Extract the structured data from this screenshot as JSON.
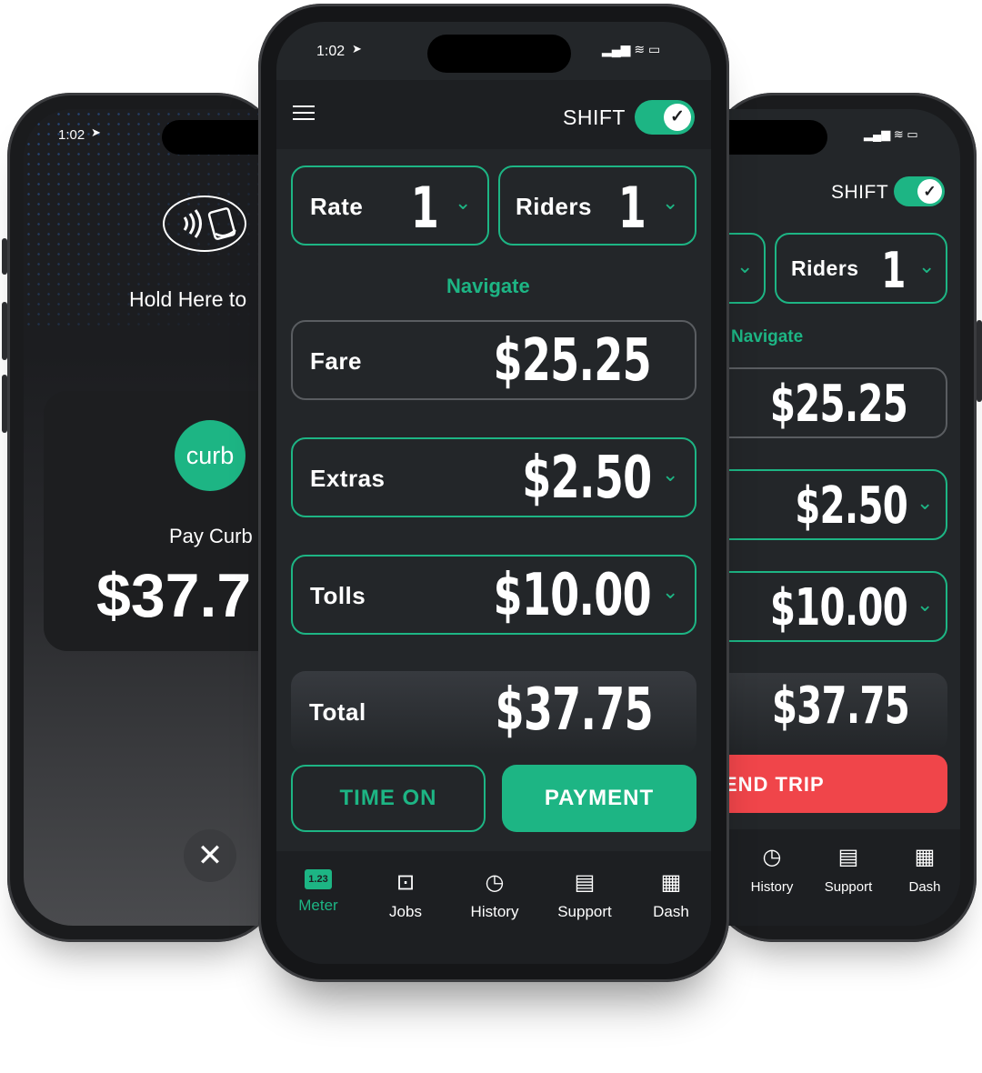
{
  "left_phone": {
    "time": "1:02",
    "hold_text": "Hold Here to",
    "logo_text": "curb",
    "pay_label": "Pay Curb",
    "amount": "$37.7",
    "close_icon": "close-icon"
  },
  "center_phone": {
    "time": "1:02",
    "shift_label": "SHIFT",
    "rate_label": "Rate",
    "rate_value": "1",
    "riders_label": "Riders",
    "riders_value": "1",
    "navigate": "Navigate",
    "fare_label": "Fare",
    "fare_value": "$25.25",
    "extras_label": "Extras",
    "extras_value": "$2.50",
    "tolls_label": "Tolls",
    "tolls_value": "$10.00",
    "total_label": "Total",
    "total_value": "$37.75",
    "time_on": "TIME ON",
    "payment": "PAYMENT",
    "tabs": [
      {
        "label": "Meter",
        "icon": "meter-icon"
      },
      {
        "label": "Jobs",
        "icon": "jobs-icon"
      },
      {
        "label": "History",
        "icon": "history-icon"
      },
      {
        "label": "Support",
        "icon": "support-icon"
      },
      {
        "label": "Dash",
        "icon": "dash-icon"
      }
    ],
    "meter_icon_text": "1.23"
  },
  "right_phone": {
    "shift_label": "SHIFT",
    "riders_label": "Riders",
    "riders_value": "1",
    "navigate": "Navigate",
    "fare_value": "$25.25",
    "extras_value": "$2.50",
    "tolls_value": "$10.00",
    "total_value": "$37.75",
    "end_trip": "END TRIP",
    "tabs": [
      {
        "label": "History"
      },
      {
        "label": "Support"
      },
      {
        "label": "Dash"
      }
    ]
  },
  "colors": {
    "accent": "#1db584",
    "danger": "#f0454a",
    "bg": "#232629"
  }
}
